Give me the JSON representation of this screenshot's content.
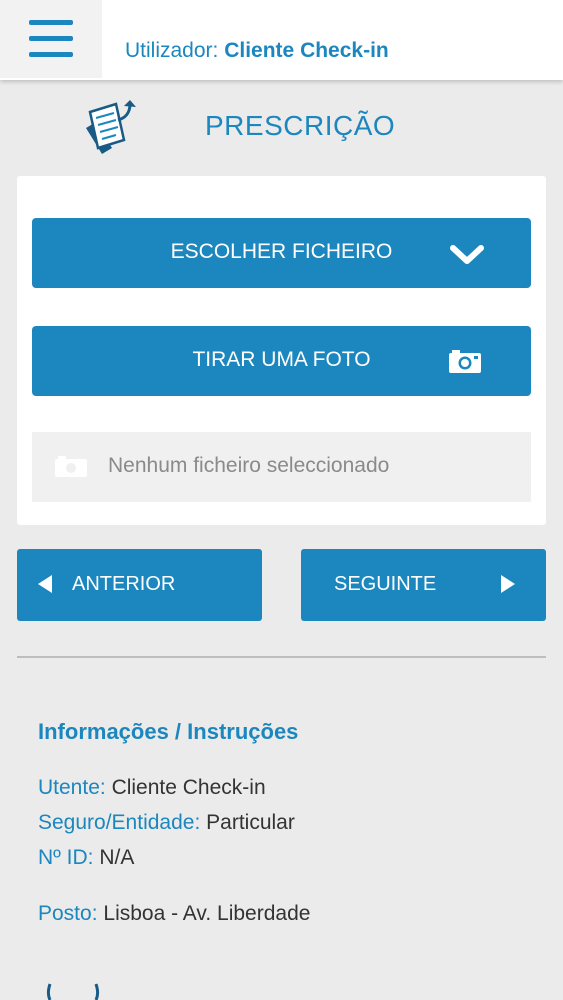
{
  "header": {
    "user_prefix": "Utilizador:",
    "user_name": "Cliente Check-in"
  },
  "page": {
    "title": "PRESCRIÇÃO"
  },
  "upload": {
    "choose_file_label": "ESCOLHER FICHEIRO",
    "take_photo_label": "TIRAR UMA FOTO",
    "file_status": "Nenhum ficheiro seleccionado"
  },
  "nav": {
    "previous_label": "ANTERIOR",
    "next_label": "SEGUINTE"
  },
  "info": {
    "title": "Informações / Instruções",
    "patient_key": "Utente:",
    "patient_value": "Cliente Check-in",
    "insurance_key": "Seguro/Entidade:",
    "insurance_value": "Particular",
    "id_key": "Nº ID:",
    "id_value": "N/A",
    "post_key": "Posto:",
    "post_value": "Lisboa - Av. Liberdade"
  },
  "icons": {
    "menu": "hamburger-menu-icon",
    "document": "prescription-document-icon",
    "chevron": "chevron-down-icon",
    "camera": "camera-icon",
    "file": "file-placeholder-icon",
    "prev": "arrow-left-icon",
    "next": "arrow-right-icon"
  },
  "colors": {
    "primary": "#1b87be",
    "background": "#ebebeb",
    "text": "#333333",
    "muted": "#8a8a8a"
  }
}
